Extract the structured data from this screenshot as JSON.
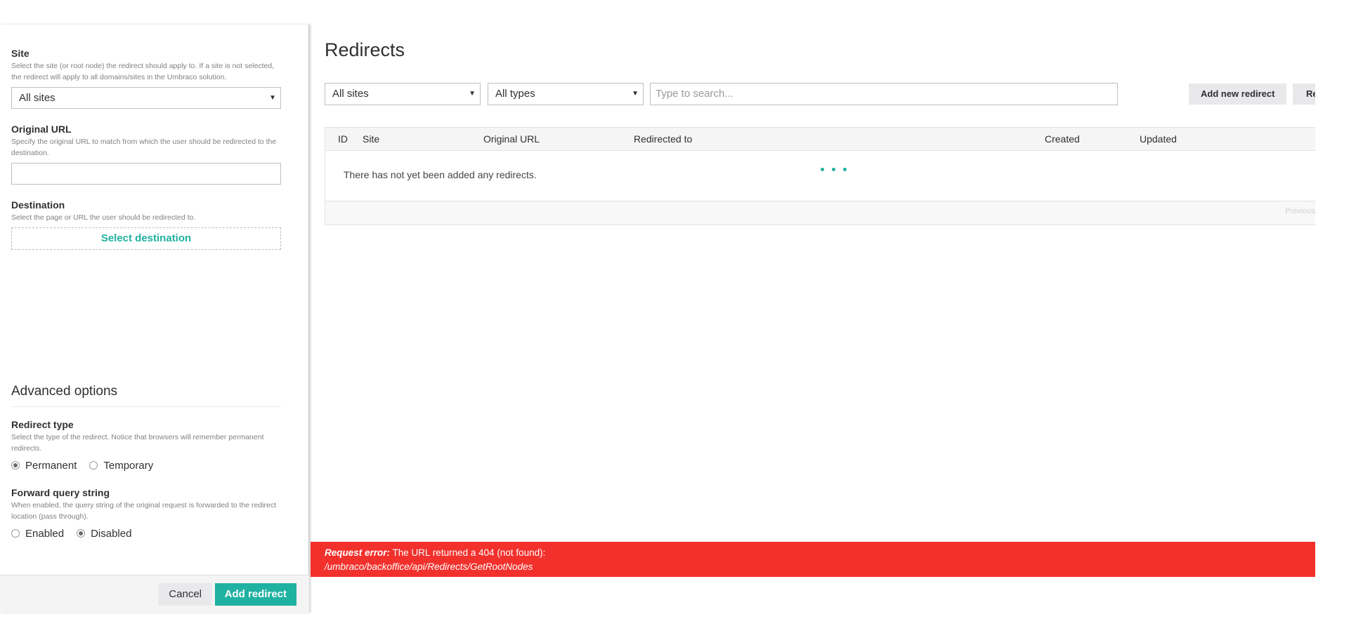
{
  "panel": {
    "site": {
      "label": "Site",
      "description": "Select the site (or root node) the redirect should apply to. If a site is not selected, the redirect will apply to all domains/sites in the Umbraco solution.",
      "value": "All sites"
    },
    "original_url": {
      "label": "Original URL",
      "description": "Specify the original URL to match from which the user should be redirected to the destination.",
      "value": ""
    },
    "destination": {
      "label": "Destination",
      "description": "Select the page or URL the user should be redirected to.",
      "button_label": "Select destination"
    },
    "advanced": {
      "title": "Advanced options",
      "redirect_type": {
        "label": "Redirect type",
        "description": "Select the type of the redirect. Notice that browsers will remember permanent redirects.",
        "options": [
          "Permanent",
          "Temporary"
        ],
        "selected": "Permanent"
      },
      "forward_query": {
        "label": "Forward query string",
        "description": "When enabled, the query string of the original request is forwarded to the redirect location (pass through).",
        "options": [
          "Enabled",
          "Disabled"
        ],
        "selected": "Disabled"
      }
    },
    "footer": {
      "cancel_label": "Cancel",
      "submit_label": "Add redirect"
    }
  },
  "main": {
    "title": "Redirects",
    "filters": {
      "site_value": "All sites",
      "type_value": "All types",
      "search_placeholder": "Type to search..."
    },
    "buttons": {
      "add_new": "Add new redirect",
      "second_truncated": "Re"
    },
    "table": {
      "columns": [
        "ID",
        "Site",
        "Original URL",
        "Redirected to",
        "Created",
        "Updated"
      ],
      "empty_message": "There has not yet been added any redirects.",
      "pager_prev": "Previous"
    }
  },
  "error": {
    "prefix": "Request error:",
    "message": "The URL returned a 404 (not found):",
    "path": "/umbraco/backoffice/api/Redirects/GetRootNodes"
  },
  "colors": {
    "accent": "#1fb1a1",
    "error": "#f2302c"
  }
}
